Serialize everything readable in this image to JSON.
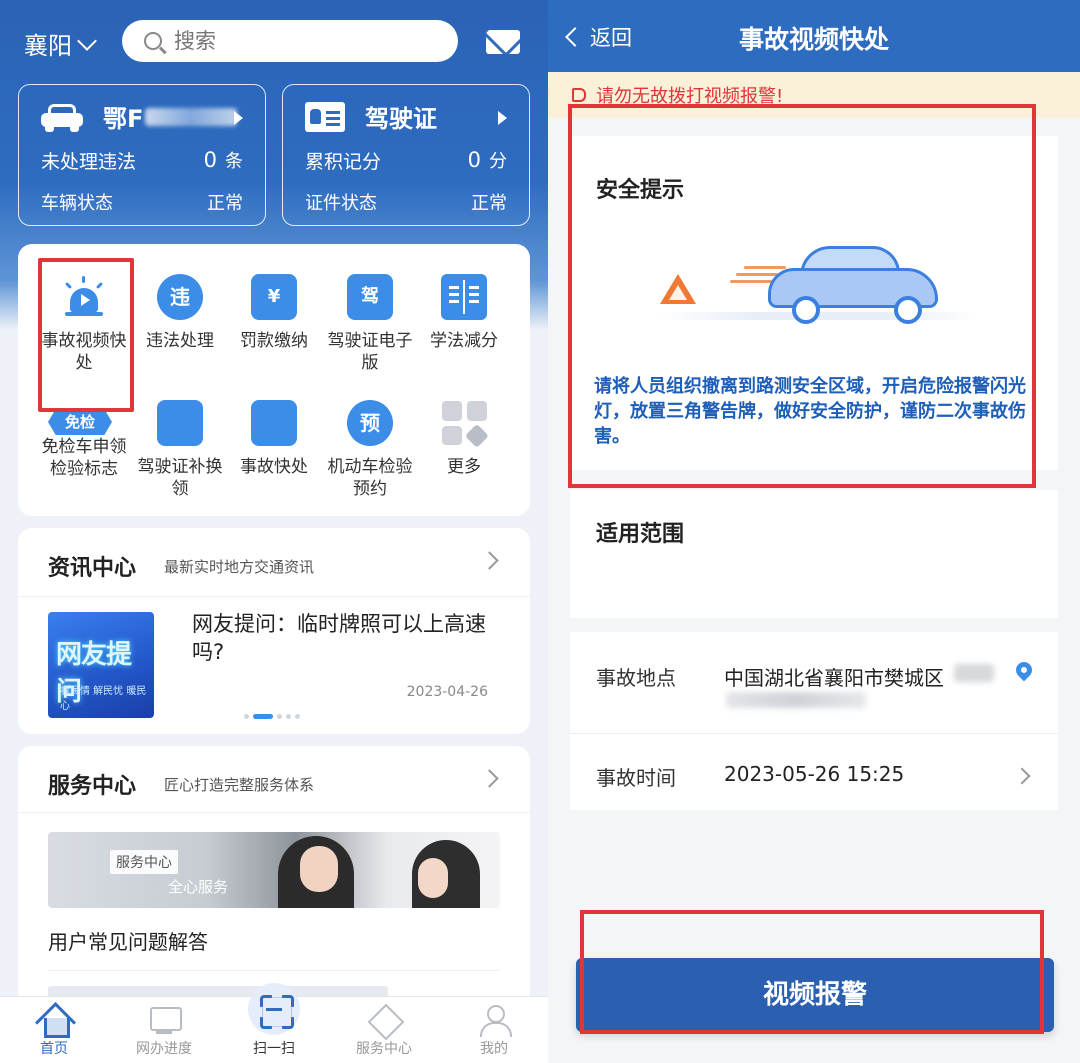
{
  "left": {
    "header": {
      "city": "襄阳",
      "search_placeholder": "搜索"
    },
    "vehicle_card": {
      "plate_prefix": "鄂F",
      "violations_label": "未处理违法",
      "violations_value": "0",
      "violations_unit": "条",
      "status_label": "车辆状态",
      "status_value": "正常"
    },
    "license_card": {
      "title": "驾驶证",
      "points_label": "累积记分",
      "points_value": "0",
      "points_unit": "分",
      "status_label": "证件状态",
      "status_value": "正常"
    },
    "services": [
      {
        "label": "事故视频快处",
        "icon": "police-light-icon"
      },
      {
        "label": "违法处理",
        "icon": "violation-search-icon",
        "glyph": "违"
      },
      {
        "label": "罚款缴纳",
        "icon": "receipt-icon",
        "glyph": "¥"
      },
      {
        "label": "驾驶证电子版",
        "icon": "license-card-icon",
        "glyph": "驾"
      },
      {
        "label": "学法减分",
        "icon": "book-icon"
      },
      {
        "label": "免检车申领检验标志",
        "icon": "exempt-badge-icon",
        "badge": "免检"
      },
      {
        "label": "驾驶证补换领",
        "icon": "license-renew-icon"
      },
      {
        "label": "事故快处",
        "icon": "car-accident-icon"
      },
      {
        "label": "机动车检验预约",
        "icon": "truck-appointment-icon",
        "glyph": "预"
      },
      {
        "label": "更多",
        "icon": "more-grid-icon"
      }
    ],
    "news": {
      "title": "资讯中心",
      "subtitle": "最新实时地方交通资讯",
      "thumb_title": "网友提问",
      "thumb_sub": "看民情 解民忧 暖民心",
      "headline": "网友提问：临时牌照可以上高速吗?",
      "date": "2023-04-26"
    },
    "service_center": {
      "title": "服务中心",
      "subtitle": "匠心打造完整服务体系",
      "banner_tag": "服务中心",
      "banner_sub": "全心服务",
      "faq": "用户常见问题解答"
    },
    "tabbar": [
      {
        "label": "首页",
        "icon": "home-icon"
      },
      {
        "label": "网办进度",
        "icon": "monitor-icon"
      },
      {
        "label": "扫一扫",
        "icon": "scan-icon"
      },
      {
        "label": "服务中心",
        "icon": "handshake-icon"
      },
      {
        "label": "我的",
        "icon": "user-icon"
      }
    ]
  },
  "right": {
    "nav": {
      "back": "返回",
      "title": "事故视频快处"
    },
    "warning": "请勿无故拨打视频报警!",
    "safety": {
      "title": "安全提示",
      "text": "请将人员组织撤离到路测安全区域，开启危险报警闪光灯，放置三角警告牌，做好安全防护，谨防二次事故伤害。"
    },
    "scope": {
      "title": "适用范围"
    },
    "form": {
      "location_label": "事故地点",
      "location_value": "中国湖北省襄阳市樊城区",
      "time_label": "事故时间",
      "time_value": "2023-05-26 15:25"
    },
    "report_button": "视频报警"
  },
  "colors": {
    "brand_blue": "#2e6cc0",
    "icon_blue": "#3b8de8",
    "highlight_red": "#e0363a",
    "tip_text_blue": "#1f5fb8"
  }
}
